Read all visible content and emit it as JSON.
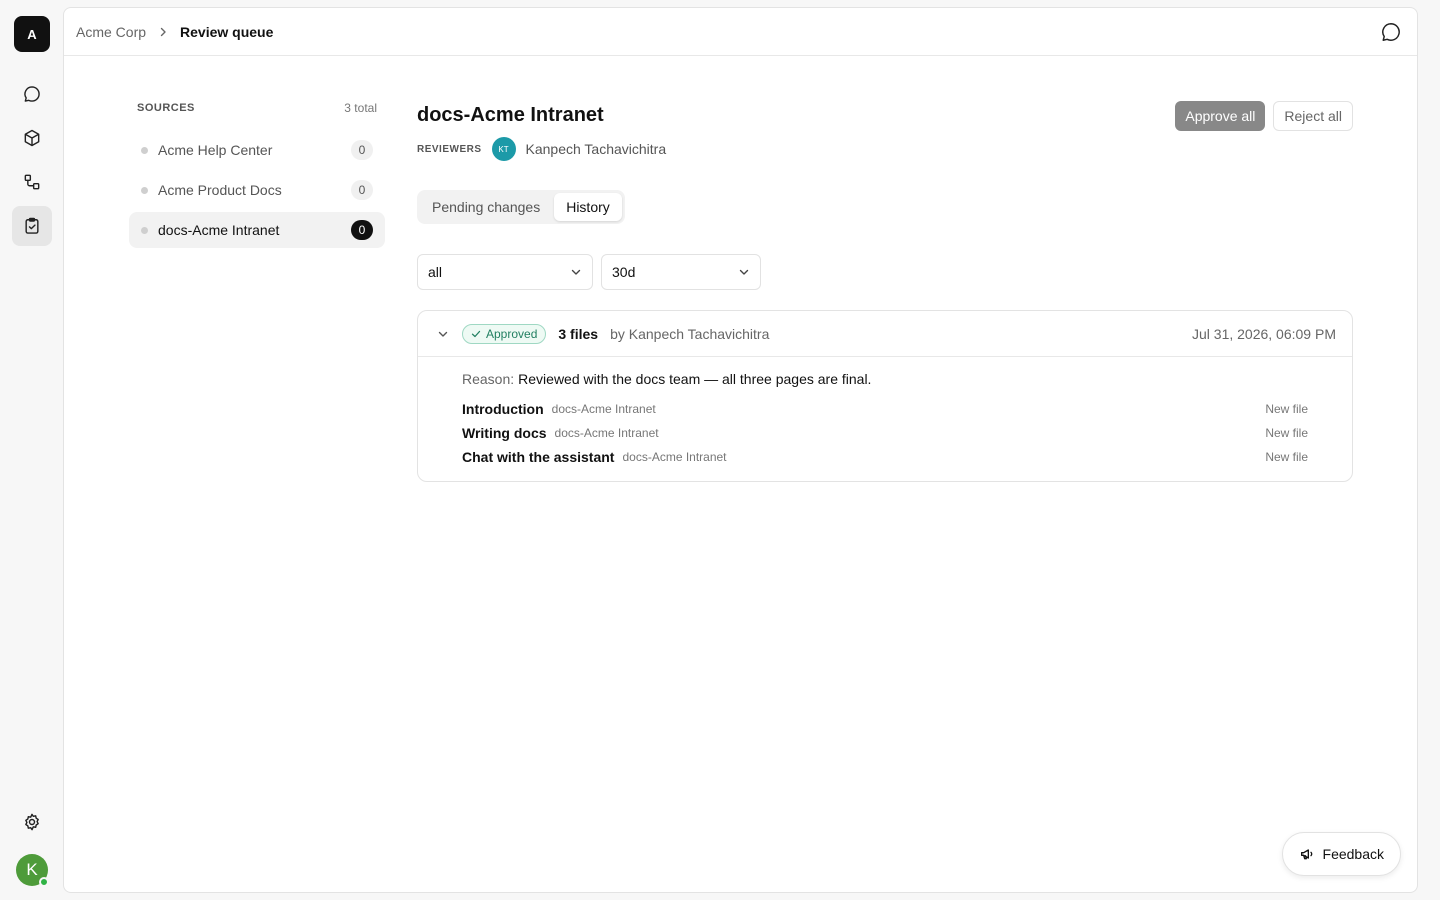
{
  "rail": {
    "org_initial": "A",
    "nav": [
      {
        "name": "chat",
        "icon": "chat-bubble-icon",
        "active": false
      },
      {
        "name": "knowledge",
        "icon": "cube-icon",
        "active": false
      },
      {
        "name": "workflows",
        "icon": "flow-icon",
        "active": false
      },
      {
        "name": "review-queue",
        "icon": "clipboard-check-icon",
        "active": true
      }
    ],
    "settings_icon": "gear-icon",
    "user_initial": "K",
    "user_status": "online"
  },
  "breadcrumb": {
    "root": "Acme Corp",
    "current": "Review queue"
  },
  "sources": {
    "title": "SOURCES",
    "count_label": "3 total",
    "items": [
      {
        "label": "Acme Help Center",
        "count": "0",
        "active": false
      },
      {
        "label": "Acme Product Docs",
        "count": "0",
        "active": false
      },
      {
        "label": "docs-Acme Intranet",
        "count": "0",
        "active": true
      }
    ]
  },
  "content": {
    "title": "docs-Acme Intranet",
    "reviewers_label": "REVIEWERS",
    "reviewer": {
      "initials": "KT",
      "name": "Kanpech Tachavichitra"
    },
    "approve_label": "Approve all",
    "reject_label": "Reject all",
    "tabs": [
      {
        "label": "Pending changes",
        "active": false
      },
      {
        "label": "History",
        "active": true
      }
    ],
    "filters": {
      "status": "all",
      "range": "30d"
    },
    "history": {
      "badge": "Approved",
      "file_count": "3 files",
      "by": "by Kanpech Tachavichitra",
      "date": "Jul 31, 2026, 06:09 PM",
      "reason_label": "Reason:",
      "reason": "Reviewed with the docs team — all three pages are final.",
      "files": [
        {
          "name": "Introduction",
          "source": "docs-Acme Intranet",
          "status": "New file"
        },
        {
          "name": "Writing docs",
          "source": "docs-Acme Intranet",
          "status": "New file"
        },
        {
          "name": "Chat with the assistant",
          "source": "docs-Acme Intranet",
          "status": "New file"
        }
      ]
    }
  },
  "feedback_label": "Feedback",
  "colors": {
    "accent_dark": "#111111",
    "approved_green": "#238062",
    "reviewer_teal": "#1c9aa8",
    "user_green": "#4e9b3a"
  }
}
